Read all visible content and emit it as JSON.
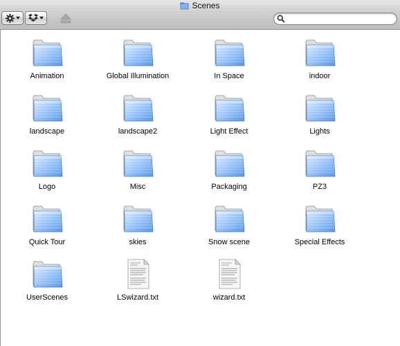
{
  "window": {
    "title": "Scenes"
  },
  "toolbar": {
    "action_icon": "gear-icon",
    "dropbox_icon": "dropbox-icon",
    "eject_icon": "eject-icon",
    "search_icon": "search-icon",
    "search_value": ""
  },
  "items": [
    {
      "label": "Animation",
      "type": "folder"
    },
    {
      "label": "Global Illumination",
      "type": "folder"
    },
    {
      "label": "In Space",
      "type": "folder"
    },
    {
      "label": "indoor",
      "type": "folder"
    },
    {
      "label": "landscape",
      "type": "folder"
    },
    {
      "label": "landscape2",
      "type": "folder"
    },
    {
      "label": "Light Effect",
      "type": "folder"
    },
    {
      "label": "Lights",
      "type": "folder"
    },
    {
      "label": "Logo",
      "type": "folder"
    },
    {
      "label": "Misc",
      "type": "folder"
    },
    {
      "label": "Packaging",
      "type": "folder"
    },
    {
      "label": "PZ3",
      "type": "folder"
    },
    {
      "label": "Quick Tour",
      "type": "folder"
    },
    {
      "label": "skies",
      "type": "folder"
    },
    {
      "label": "Snow scene",
      "type": "folder"
    },
    {
      "label": "Special Effects",
      "type": "folder"
    },
    {
      "label": "UserScenes",
      "type": "folder"
    },
    {
      "label": "LSwizard.txt",
      "type": "text-file"
    },
    {
      "label": "wizard.txt",
      "type": "text-file"
    }
  ],
  "colors": {
    "folder_light": "#cfe3ff",
    "folder_dark": "#5f9de8",
    "toolbar_top": "#e8e8e8",
    "toolbar_bottom": "#bdbdbd"
  }
}
